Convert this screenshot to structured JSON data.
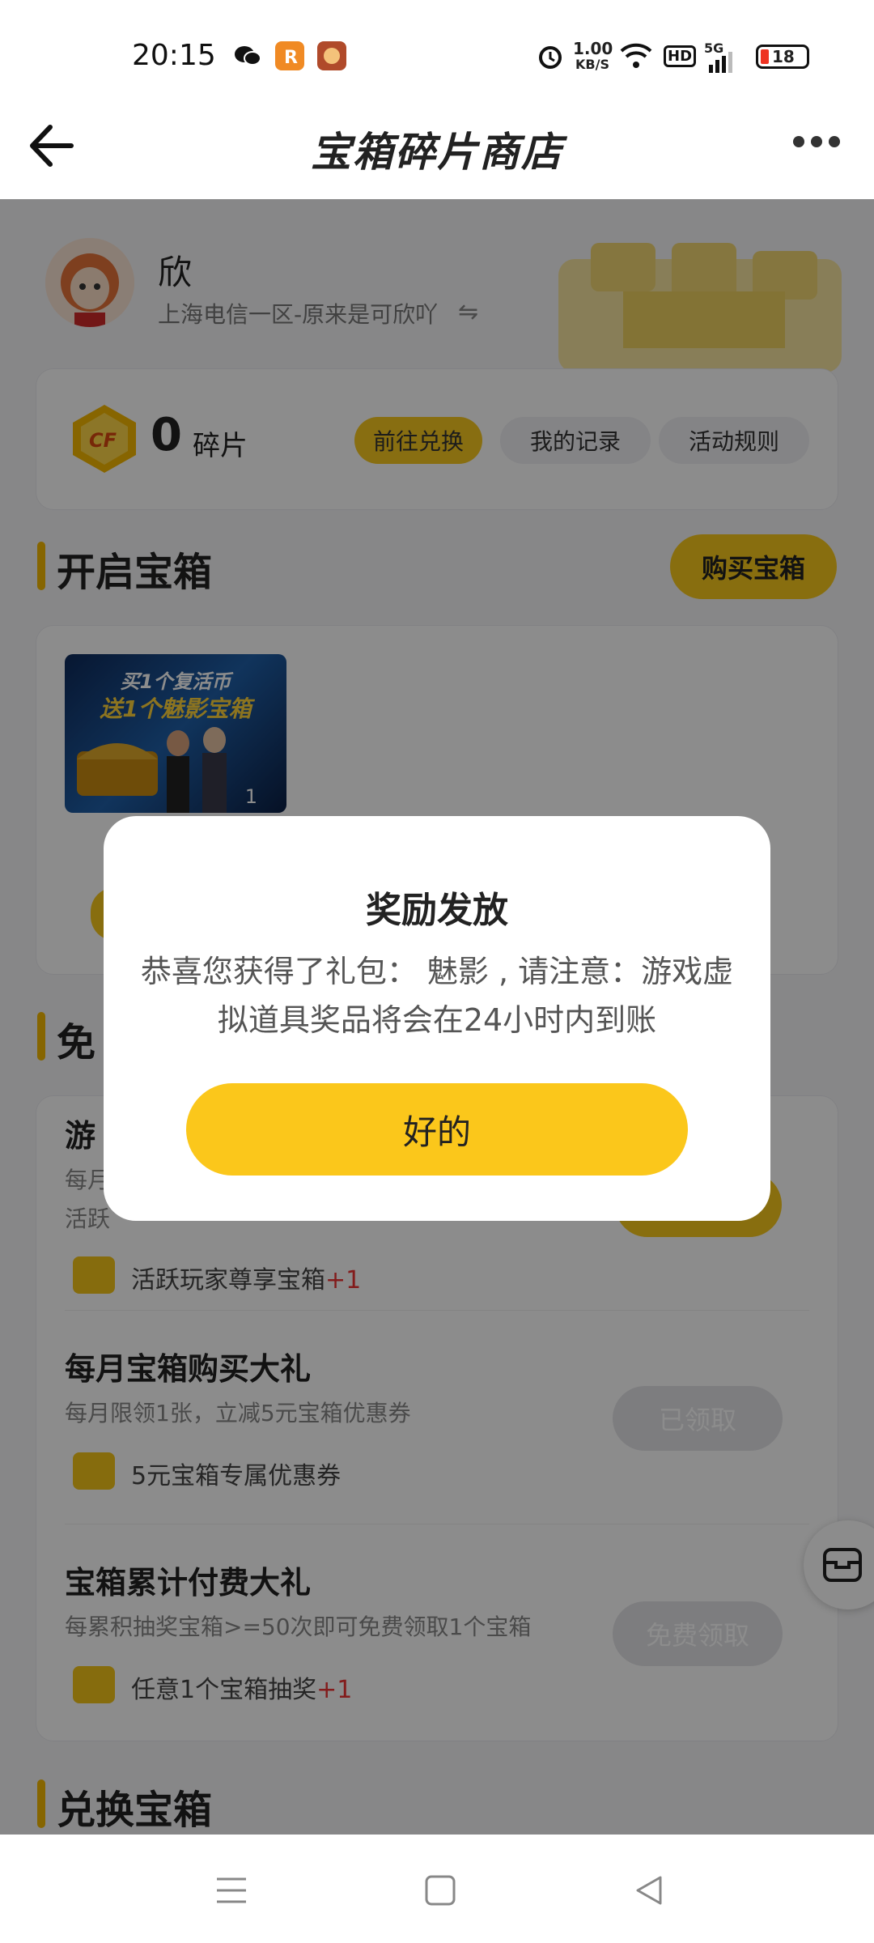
{
  "status_bar": {
    "time": "20:15",
    "net_speed_value": "1.00",
    "net_speed_unit": "KB/S",
    "hd": "HD",
    "signal_label": "5G",
    "battery": "18",
    "icons": [
      "wechat-icon",
      "app-icon",
      "game-icon",
      "alarm-icon",
      "wifi-icon",
      "signal-icon",
      "battery-icon"
    ]
  },
  "header": {
    "title": "宝箱碎片商店",
    "back_icon": "back-arrow-icon",
    "more_icon": "more-icon"
  },
  "profile": {
    "name": "欣",
    "server": "上海电信一区-原来是可欣吖",
    "switch_icon": "switch-icon"
  },
  "fragments": {
    "count": "0",
    "unit": "碎片",
    "buttons": [
      "前往兑换",
      "我的记录",
      "活动规则"
    ]
  },
  "open_box": {
    "title": "开启宝箱",
    "buy_label": "购买宝箱",
    "banner_line1": "买1个复活币",
    "banner_line2": "送1个魅影宝箱",
    "banner_count": "1"
  },
  "free_section": {
    "title_partial": "免",
    "items": [
      {
        "title": "游",
        "desc1": "每月",
        "desc2": "活跃",
        "reward": "活跃玩家尊享宝箱",
        "reward_plus": "+1"
      },
      {
        "title": "每月宝箱购买大礼",
        "desc": "每月限领1张，立减5元宝箱优惠券",
        "reward": "5元宝箱专属优惠券",
        "button": "已领取"
      },
      {
        "title": "宝箱累计付费大礼",
        "desc": "每累积抽奖宝箱>=50次即可免费领取1个宝箱",
        "reward": "任意1个宝箱抽奖",
        "reward_plus": "+1",
        "button": "免费领取"
      }
    ]
  },
  "exchange_section": {
    "title": "兑换宝箱"
  },
  "dialog": {
    "title": "奖励发放",
    "message": "恭喜您获得了礼包： 魅影 , 请注意：游戏虚拟道具奖品将会在24小时内到账",
    "ok_label": "好的"
  },
  "colors": {
    "accent": "#fbc71b",
    "plus": "#e33333"
  }
}
